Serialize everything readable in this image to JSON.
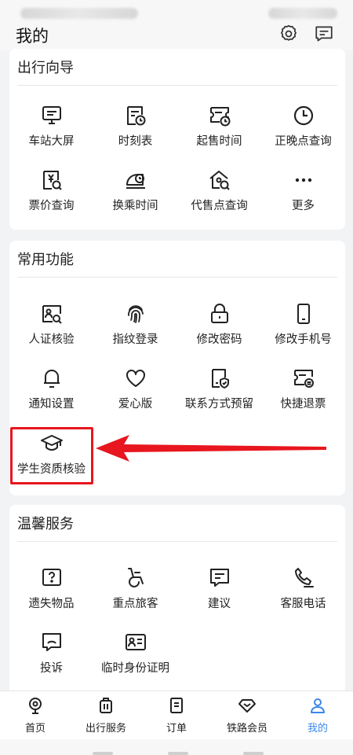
{
  "header": {
    "title": "我的"
  },
  "sections": {
    "travel_guide": {
      "title": "出行向导",
      "items": [
        {
          "label": "车站大屏",
          "icon": "monitor-icon"
        },
        {
          "label": "时刻表",
          "icon": "timetable-icon"
        },
        {
          "label": "起售时间",
          "icon": "sale-time-icon"
        },
        {
          "label": "正晚点查询",
          "icon": "clock-icon"
        },
        {
          "label": "票价查询",
          "icon": "fare-query-icon"
        },
        {
          "label": "换乘时间",
          "icon": "transfer-time-icon"
        },
        {
          "label": "代售点查询",
          "icon": "agency-query-icon"
        },
        {
          "label": "更多",
          "icon": "more-icon"
        }
      ]
    },
    "common_functions": {
      "title": "常用功能",
      "items": [
        {
          "label": "人证核验",
          "icon": "id-verify-icon"
        },
        {
          "label": "指纹登录",
          "icon": "fingerprint-icon"
        },
        {
          "label": "修改密码",
          "icon": "lock-icon"
        },
        {
          "label": "修改手机号",
          "icon": "phone-icon"
        },
        {
          "label": "通知设置",
          "icon": "bell-icon"
        },
        {
          "label": "爱心版",
          "icon": "heart-icon"
        },
        {
          "label": "联系方式预留",
          "icon": "contact-shield-icon"
        },
        {
          "label": "快捷退票",
          "icon": "refund-ticket-icon"
        },
        {
          "label": "学生资质核验",
          "icon": "graduation-cap-icon"
        }
      ]
    },
    "warm_services": {
      "title": "温馨服务",
      "items": [
        {
          "label": "遗失物品",
          "icon": "question-box-icon"
        },
        {
          "label": "重点旅客",
          "icon": "wheelchair-icon"
        },
        {
          "label": "建议",
          "icon": "suggestion-icon"
        },
        {
          "label": "客服电话",
          "icon": "phone-call-icon"
        },
        {
          "label": "投诉",
          "icon": "complaint-icon"
        },
        {
          "label": "临时身份证明",
          "icon": "id-card-icon"
        }
      ]
    }
  },
  "tabbar": [
    {
      "label": "首页",
      "icon": "home-icon"
    },
    {
      "label": "出行服务",
      "icon": "luggage-icon"
    },
    {
      "label": "订单",
      "icon": "order-icon"
    },
    {
      "label": "铁路会员",
      "icon": "diamond-icon"
    },
    {
      "label": "我的",
      "icon": "user-icon",
      "active": true
    }
  ],
  "colors": {
    "accent": "#3b87e8",
    "highlight": "#e8161e",
    "text": "#222222"
  }
}
